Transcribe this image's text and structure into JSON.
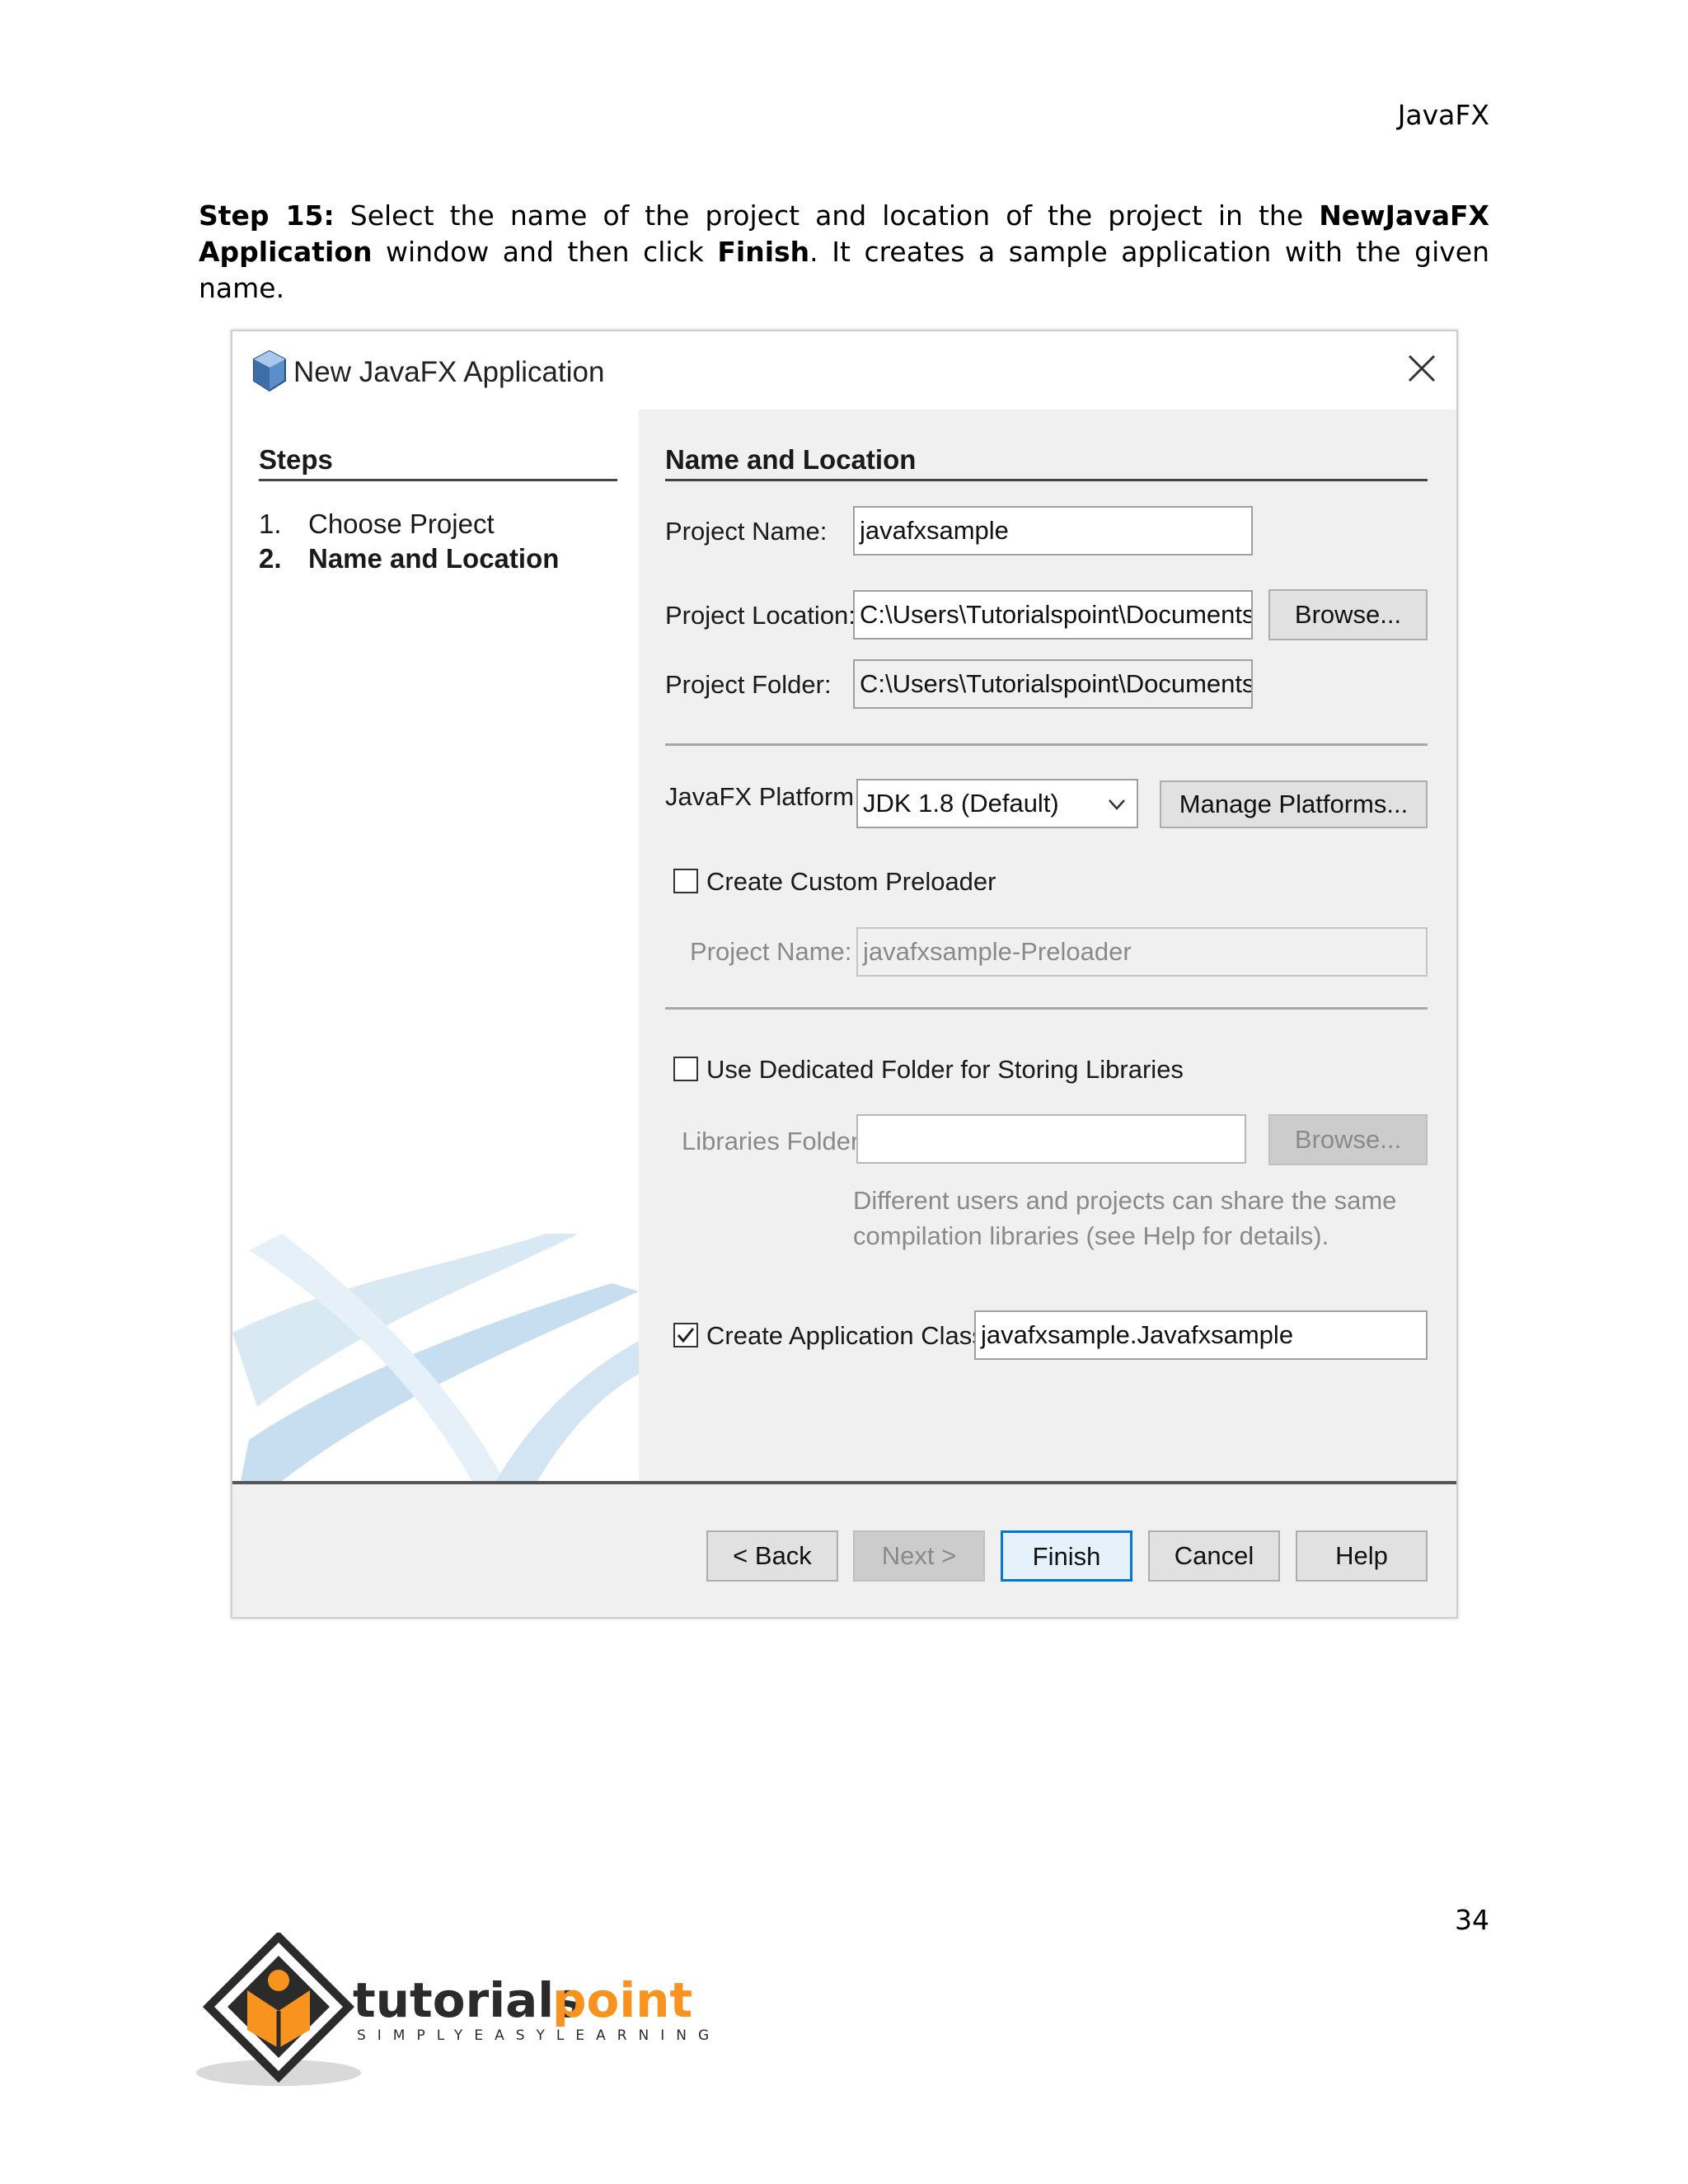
{
  "running_header": "JavaFX",
  "intro": {
    "step_label": "Step 15:",
    "text_1": " Select the name of the project and location of the project in the ",
    "bold_1": "NewJavaFX Application",
    "text_2": " window and then click ",
    "bold_2": "Finish",
    "text_3": ". It creates a sample application with the given name."
  },
  "dialog": {
    "title": "New JavaFX Application",
    "steps": {
      "heading": "Steps",
      "items": [
        {
          "num": "1.",
          "label": "Choose Project"
        },
        {
          "num": "2.",
          "label": "Name and Location"
        }
      ]
    },
    "section_title": "Name and Location",
    "project_name_label": "Project Name:",
    "project_name_value": "javafxsample",
    "project_location_label": "Project Location:",
    "project_location_value": "C:\\Users\\Tutorialspoint\\Documents\\Net",
    "browse_label": "Browse...",
    "project_folder_label": "Project Folder:",
    "project_folder_value": "C:\\Users\\Tutorialspoint\\Documents\\Net",
    "platform_label": "JavaFX Platform:",
    "platform_value": "JDK 1.8 (Default)",
    "manage_platforms_label": "Manage Platforms...",
    "preloader_checkbox_label": "Create Custom Preloader",
    "preloader_checked": false,
    "preloader_name_label": "Project Name:",
    "preloader_name_value": "javafxsample-Preloader",
    "dedicated_folder_label": "Use Dedicated Folder for Storing Libraries",
    "dedicated_folder_checked": false,
    "libraries_folder_label": "Libraries Folder:",
    "libraries_folder_value": "",
    "libraries_browse_label": "Browse...",
    "libraries_hint_line1": "Different users and projects can share the same",
    "libraries_hint_line2": "compilation libraries (see Help for details).",
    "app_class_label": "Create Application Class",
    "app_class_checked": true,
    "app_class_value": "javafxsample.Javafxsample",
    "buttons": {
      "back": "< Back",
      "next": "Next >",
      "finish": "Finish",
      "cancel": "Cancel",
      "help": "Help"
    }
  },
  "page_number": "34",
  "logo": {
    "name_part1": "tutorials",
    "name_part2": "point",
    "tagline": "SIMPLYEASYLEARNING",
    "colors": {
      "dark": "#2b2b2b",
      "orange": "#f7931e"
    }
  }
}
